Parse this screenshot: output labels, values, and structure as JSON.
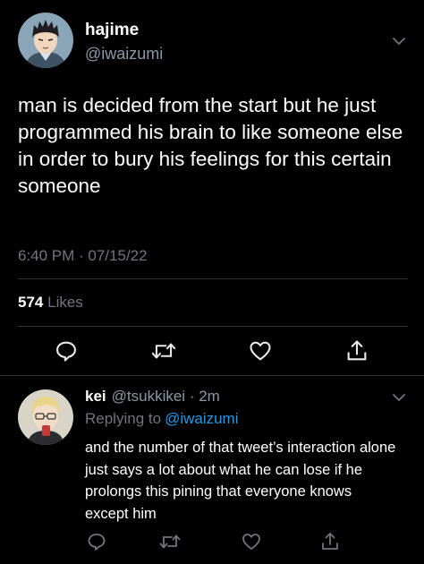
{
  "tweet": {
    "name": "hajime",
    "handle": "@iwaizumi",
    "text": "man is decided from the start but he just programmed his brain to like someone else in order to bury his feelings for this certain someone",
    "timestamp": "6:40 PM · 07/15/22",
    "likes_count": "574",
    "likes_label": "Likes"
  },
  "reply": {
    "name": "kei",
    "handle": "@tsukkikei",
    "time": " · 2m",
    "replying_label": "Replying to",
    "replying_to": "@iwaizumi",
    "text": "and the number of that tweet’s interaction alone just says a lot about what he can lose if he prolongs this pining that everyone knows except him"
  },
  "icons": {
    "more": "chevron-down-icon",
    "reply": "comment-bubble-icon",
    "retweet": "retweet-icon",
    "like": "heart-icon",
    "share": "share-icon"
  },
  "colors": {
    "background": "#000000",
    "text": "#e7e9ea",
    "secondary": "#71767b",
    "link": "#1d9bf0",
    "divider": "#2f3336"
  }
}
